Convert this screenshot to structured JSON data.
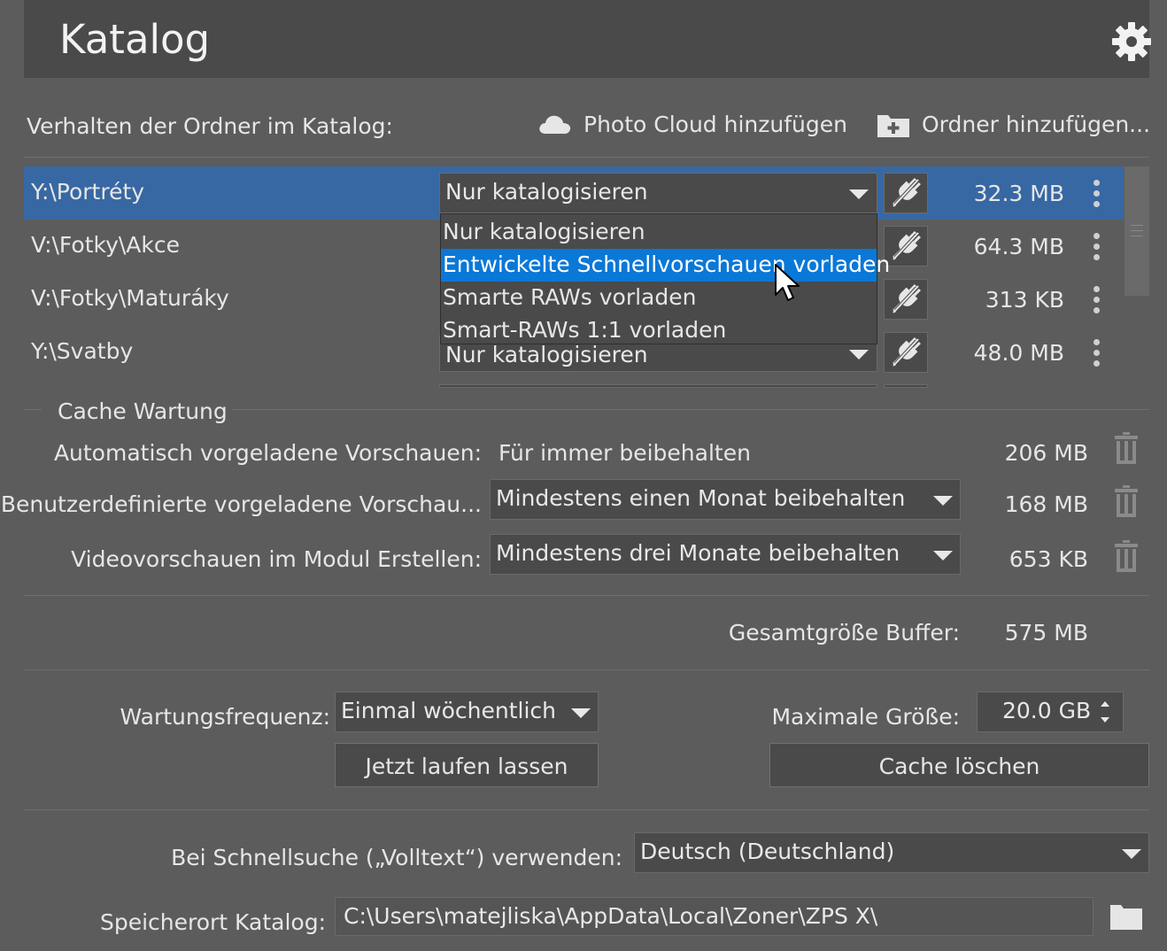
{
  "header": {
    "title": "Katalog"
  },
  "folders": {
    "label": "Verhalten der Ordner im Katalog:",
    "photo_cloud": "Photo Cloud hinzufügen",
    "add_folder": "Ordner hinzufügen...",
    "rows": [
      {
        "path": "Y:\\Portréty",
        "mode": "Nur katalogisieren",
        "size": "32.3 MB"
      },
      {
        "path": "V:\\Fotky\\Akce",
        "mode": "",
        "size": "64.3 MB"
      },
      {
        "path": "V:\\Fotky\\Maturáky",
        "mode": "",
        "size": "313 KB"
      },
      {
        "path": "Y:\\Svatby",
        "mode": "Nur katalogisieren",
        "size": "48.0 MB"
      }
    ],
    "popup_options": [
      "Nur katalogisieren",
      "Entwickelte Schnellvorschauen vorladen",
      "Smarte RAWs vorladen",
      "Smart-RAWs 1:1 vorladen"
    ]
  },
  "cache": {
    "section_title": "Cache Wartung",
    "auto_label": "Automatisch vorgeladene Vorschauen:",
    "auto_value": "Für immer beibehalten",
    "auto_size": "206 MB",
    "custom_label": "Benutzerdefinierte vorgeladene Vorschau...",
    "custom_value": "Mindestens einen Monat beibehalten",
    "custom_size": "168 MB",
    "video_label": "Videovorschauen im Modul Erstellen:",
    "video_value": "Mindestens drei Monate beibehalten",
    "video_size": "653 KB",
    "total_label": "Gesamtgröße Buffer:",
    "total_value": "575 MB",
    "freq_label": "Wartungsfrequenz:",
    "freq_value": "Einmal wöchentlich",
    "max_label": "Maximale Größe:",
    "max_value": "20.0 GB",
    "run_button": "Jetzt laufen lassen",
    "clear_button": "Cache löschen"
  },
  "search": {
    "label": "Bei Schnellsuche („Volltext“) verwenden:",
    "value": "Deutsch (Deutschland)"
  },
  "location": {
    "label": "Speicherort Katalog:",
    "value": "C:\\Users\\matejliska\\AppData\\Local\\Zoner\\ZPS X\\"
  },
  "colors": {
    "selection": "#3768a4",
    "highlight": "#0a78d7",
    "panel": "#5c5c5c"
  }
}
